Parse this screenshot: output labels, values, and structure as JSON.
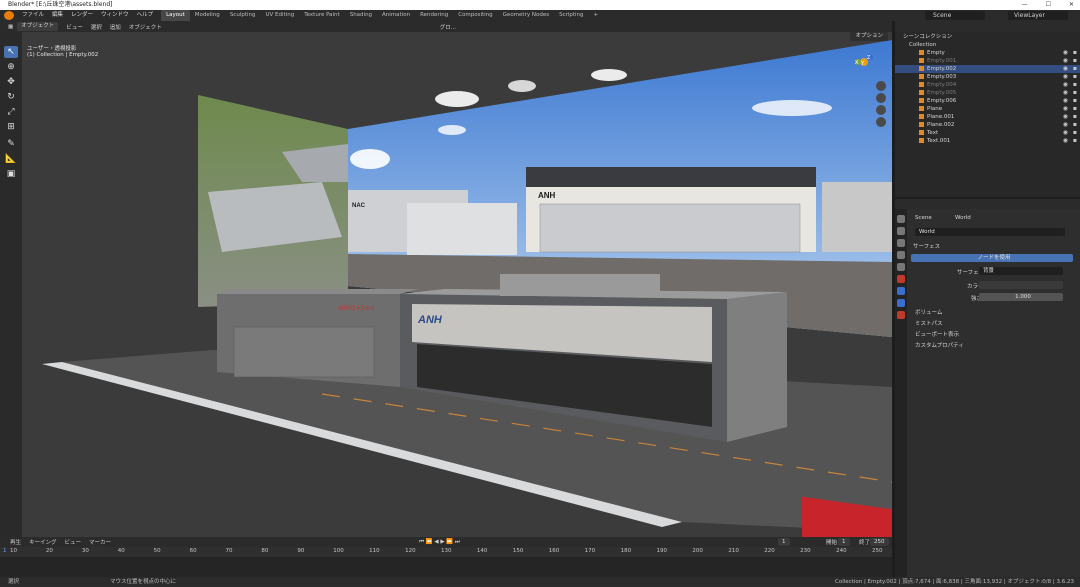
{
  "window": {
    "title": "Blender* [E:\\丘珠空港\\assets.blend]",
    "controls": [
      "—",
      "☐",
      "✕"
    ]
  },
  "topbar": {
    "menus": [
      "ファイル",
      "編集",
      "レンダー",
      "ウィンドウ",
      "ヘルプ"
    ],
    "workspaces": [
      "Layout",
      "Modeling",
      "Sculpting",
      "UV Editing",
      "Texture Paint",
      "Shading",
      "Animation",
      "Rendering",
      "Compositing",
      "Geometry Nodes",
      "Scripting"
    ],
    "active_workspace": "Layout",
    "add_tab": "+",
    "scene_label": "Scene",
    "viewlayer_label": "ViewLayer"
  },
  "viewport": {
    "menus": [
      "ビュー",
      "選択",
      "追加",
      "オブジェクト"
    ],
    "mode": "オブジェクト",
    "transform": "グロ...",
    "perspective_label": "ユーザー・透視投影",
    "context_label": "(1) Collection | Empty.002",
    "options_label": "オプション",
    "gizmo_axes": [
      "X",
      "Y",
      "Z"
    ],
    "signs": [
      "NAC",
      "ANH",
      "ANH",
      "AERO ASAHI"
    ],
    "colors": {
      "sky_top": "#3c79d4",
      "sky_bottom": "#a9c8ec",
      "ground": "#6b6b6b",
      "building": "#6f6f6f"
    }
  },
  "timeline": {
    "menus": [
      "再生",
      "キーイング",
      "ビュー",
      "マーカー"
    ],
    "current_frame": "1",
    "start_label": "開始",
    "start": "1",
    "end_label": "終了",
    "end": "250",
    "ticks": [
      "10",
      "20",
      "30",
      "40",
      "50",
      "60",
      "70",
      "80",
      "90",
      "100",
      "110",
      "120",
      "130",
      "140",
      "150",
      "160",
      "170",
      "180",
      "190",
      "200",
      "210",
      "220",
      "230",
      "240",
      "250"
    ],
    "playhead": "1"
  },
  "statusbar": {
    "left": "選択",
    "mid": "マウス位置を視点の中心に",
    "right": "Collection | Empty.002 | 頂点:7,674 | 面:6,838 | 三角面:13,932 | オブジェクト:0/8 | 3.6.23"
  },
  "outliner": {
    "header": "シーンコレクション",
    "collection": "Collection",
    "items": [
      {
        "name": "Empty",
        "type": "empty",
        "state": "normal"
      },
      {
        "name": "Empty.001",
        "type": "empty",
        "state": "dim"
      },
      {
        "name": "Empty.002",
        "type": "empty",
        "state": "selected"
      },
      {
        "name": "Empty.003",
        "type": "empty",
        "state": "normal"
      },
      {
        "name": "Empty.004",
        "type": "empty",
        "state": "dim"
      },
      {
        "name": "Empty.005",
        "type": "empty",
        "state": "dim"
      },
      {
        "name": "Empty.006",
        "type": "empty",
        "state": "normal"
      },
      {
        "name": "Plane",
        "type": "mesh",
        "state": "normal"
      },
      {
        "name": "Plane.001",
        "type": "mesh",
        "state": "normal"
      },
      {
        "name": "Plane.002",
        "type": "mesh",
        "state": "normal"
      },
      {
        "name": "Text",
        "type": "text",
        "state": "normal"
      },
      {
        "name": "Text.001",
        "type": "text",
        "state": "normal"
      }
    ]
  },
  "properties": {
    "breadcrumb_scene": "Scene",
    "breadcrumb_world": "World",
    "world_name": "World",
    "surface_panel": "サーフェス",
    "use_nodes_button": "ノードを使用",
    "surface_label": "サーフェス",
    "surface_value": "背景",
    "color_label": "カラー",
    "strength_label": "強さ",
    "strength_value": "1.000",
    "panels": [
      "ボリューム",
      "ミストパス",
      "ビューポート表示",
      "カスタムプロパティ"
    ],
    "accent": "#4772b3"
  }
}
